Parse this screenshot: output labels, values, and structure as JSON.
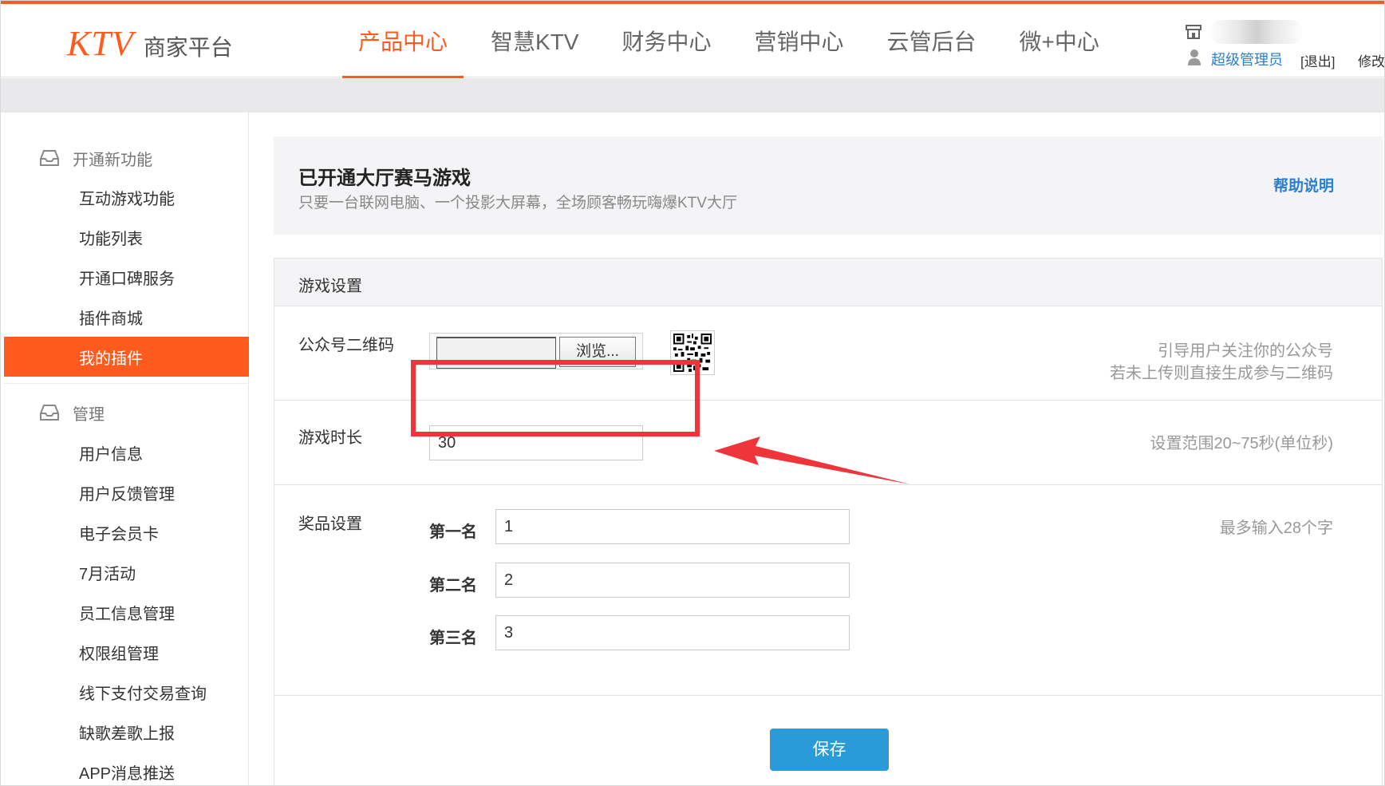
{
  "header": {
    "logo_ktv": "KTV",
    "logo_sub": "商家平台",
    "nav": [
      {
        "label": "产品中心",
        "active": true
      },
      {
        "label": "智慧KTV",
        "active": false
      },
      {
        "label": "财务中心",
        "active": false
      },
      {
        "label": "营销中心",
        "active": false
      },
      {
        "label": "云管后台",
        "active": false
      },
      {
        "label": "微+中心",
        "active": false
      }
    ],
    "user": {
      "role": "超级管理员",
      "logout": "[退出]",
      "modify": "修改"
    }
  },
  "sidebar": {
    "group1": {
      "label": "开通新功能"
    },
    "group1_items": [
      "互动游戏功能",
      "功能列表",
      "开通口碑服务",
      "插件商城",
      "我的插件"
    ],
    "group2": {
      "label": "管理"
    },
    "group2_items": [
      "用户信息",
      "用户反馈管理",
      "电子会员卡",
      "7月活动",
      "员工信息管理",
      "权限组管理",
      "线下支付交易查询",
      "缺歌差歌上报",
      "APP消息推送"
    ],
    "active_item": "我的插件"
  },
  "banner": {
    "title": "已开通大厅赛马游戏",
    "subtitle": "只要一台联网电脑、一个投影大屏幕，全场顾客畅玩嗨爆KTV大厅",
    "help": "帮助说明"
  },
  "panel": {
    "title": "游戏设置",
    "qr": {
      "label": "公众号二维码",
      "browse": "浏览...",
      "hint_line1": "引导用户关注你的公众号",
      "hint_line2": "若未上传则直接生成参与二维码"
    },
    "duration": {
      "label": "游戏时长",
      "value": "30",
      "hint": "设置范围20~75秒(单位秒)"
    },
    "prizes": {
      "label": "奖品设置",
      "hint": "最多输入28个字",
      "items": [
        {
          "rank": "第一名",
          "value": "1"
        },
        {
          "rank": "第二名",
          "value": "2"
        },
        {
          "rank": "第三名",
          "value": "3"
        }
      ]
    },
    "save": "保存"
  },
  "colors": {
    "brand": "#ff5b1f",
    "link": "#2b7fd0",
    "save": "#2a9ad8",
    "highlight": "#f0353a"
  },
  "icons": [
    "store-icon",
    "person-icon",
    "inbox-icon",
    "qr-code-icon",
    "arrow-annotation-icon"
  ]
}
